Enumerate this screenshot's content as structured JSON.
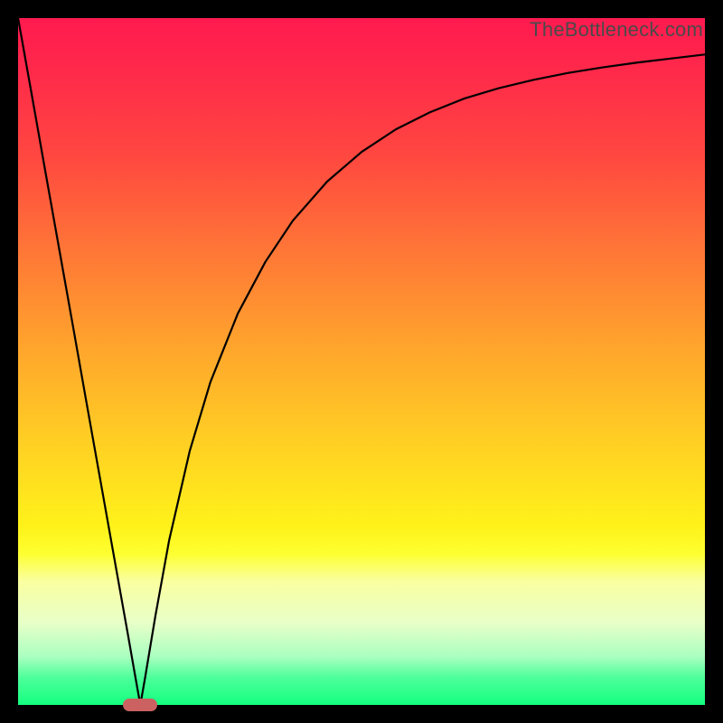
{
  "watermark": "TheBottleneck.com",
  "colors": {
    "curve": "#000000",
    "marker": "#cb6160",
    "frame": "#000000"
  },
  "chart_data": {
    "type": "line",
    "title": "",
    "xlabel": "",
    "ylabel": "",
    "xlim": [
      0,
      100
    ],
    "ylim": [
      0,
      100
    ],
    "grid": false,
    "legend": false,
    "series": [
      {
        "name": "left-branch",
        "x": [
          0,
          2,
          4,
          6,
          8,
          10,
          12,
          14,
          16,
          17,
          17.8
        ],
        "values": [
          100,
          88.8,
          77.5,
          66.3,
          55.1,
          43.8,
          32.6,
          21.4,
          10.2,
          4.5,
          0
        ]
      },
      {
        "name": "right-branch",
        "x": [
          17.8,
          18.5,
          20,
          22,
          25,
          28,
          32,
          36,
          40,
          45,
          50,
          55,
          60,
          65,
          70,
          75,
          80,
          85,
          90,
          95,
          100
        ],
        "values": [
          0,
          4,
          13,
          24,
          37,
          47,
          57,
          64.5,
          70.5,
          76.2,
          80.5,
          83.8,
          86.3,
          88.3,
          89.8,
          91,
          92,
          92.8,
          93.5,
          94.1,
          94.7
        ]
      }
    ],
    "marker": {
      "x": 17.8,
      "y": 0,
      "shape": "pill"
    }
  }
}
